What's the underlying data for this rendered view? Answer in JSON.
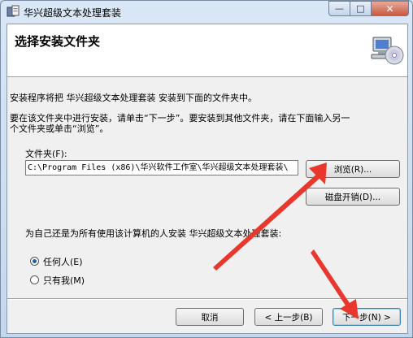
{
  "window": {
    "title": "华兴超级文本处理套装"
  },
  "caption_buttons": {
    "minimize": "—",
    "maximize": "□",
    "close": "✕"
  },
  "header": {
    "title": "选择安装文件夹"
  },
  "body": {
    "intro": "安装程序将把 华兴超级文本处理套装 安装到下面的文件夹中。",
    "hint_line1": "要在该文件夹中进行安装，请单击“下一步”。要安装到其他文件夹，请在下面输入另一",
    "hint_line2": "个文件夹或单击“浏览”。",
    "folder_label": "文件夹(F):",
    "folder_path": "C:\\Program Files (x86)\\华兴软件工作室\\华兴超级文本处理套装\\",
    "browse_label": "浏览(R)...",
    "disk_cost_label": "磁盘开销(D)...",
    "install_for_question": "为自己还是为所有使用该计算机的人安装 华兴超级文本处理套装:",
    "options": [
      {
        "label": "任何人(E)",
        "selected": true
      },
      {
        "label": "只有我(M)",
        "selected": false
      }
    ]
  },
  "footer": {
    "cancel_label": "取消",
    "back_label": "< 上一步(B)",
    "next_label": "下一步(N) >"
  },
  "annotation_color": "#e8372c"
}
